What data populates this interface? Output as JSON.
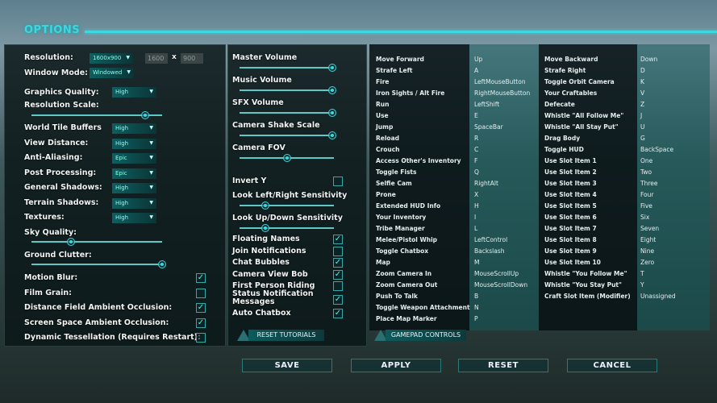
{
  "title": "OPTIONS",
  "colors": {
    "accent": "#3fd6e0",
    "panel": "#0a1618"
  },
  "graphics": {
    "resolution": {
      "label": "Resolution:",
      "value": "1600x900",
      "width": "1600",
      "x": "x",
      "height": "900"
    },
    "window_mode": {
      "label": "Window Mode:",
      "value": "Windowed"
    },
    "graphics_quality": {
      "label": "Graphics Quality:",
      "value": "High"
    },
    "resolution_scale": {
      "label": "Resolution Scale:",
      "value": 0.87
    },
    "dropdowns": [
      {
        "label": "World Tile Buffers",
        "value": "High"
      },
      {
        "label": "View Distance:",
        "value": "High"
      },
      {
        "label": "Anti-Aliasing:",
        "value": "Epic"
      },
      {
        "label": "Post Processing:",
        "value": "Epic"
      },
      {
        "label": "General Shadows:",
        "value": "High"
      },
      {
        "label": "Terrain Shadows:",
        "value": "High"
      },
      {
        "label": "Textures:",
        "value": "High"
      }
    ],
    "sky_quality": {
      "label": "Sky Quality:",
      "value": 0.3
    },
    "ground_clutter": {
      "label": "Ground Clutter:",
      "value": 1.0
    },
    "checkboxes": [
      {
        "label": "Motion Blur:",
        "checked": true
      },
      {
        "label": "Film Grain:",
        "checked": false
      },
      {
        "label": "Distance Field Ambient Occlusion:",
        "checked": true
      },
      {
        "label": "Screen Space Ambient Occlusion:",
        "checked": true
      },
      {
        "label": "Dynamic Tessellation (Requires Restart):",
        "checked": false
      }
    ]
  },
  "audio": {
    "sliders": [
      {
        "label": "Master Volume",
        "value": 0.98
      },
      {
        "label": "Music Volume",
        "value": 0.98
      },
      {
        "label": "SFX Volume",
        "value": 0.98
      },
      {
        "label": "Camera Shake Scale",
        "value": 0.98
      },
      {
        "label": "Camera FOV",
        "value": 0.5
      }
    ],
    "invert_y": {
      "label": "Invert Y",
      "checked": false
    },
    "sens": [
      {
        "label": "Look Left/Right Sensitivity",
        "value": 0.27
      },
      {
        "label": "Look Up/Down Sensitivity",
        "value": 0.27
      }
    ],
    "checkboxes": [
      {
        "label": "Floating Names",
        "checked": true
      },
      {
        "label": "Join Notifications",
        "checked": false
      },
      {
        "label": "Chat Bubbles",
        "checked": true
      },
      {
        "label": "Camera View Bob",
        "checked": true
      },
      {
        "label": "First Person Riding",
        "checked": false
      },
      {
        "label": "Status Notification Messages",
        "checked": true
      },
      {
        "label": "Auto Chatbox",
        "checked": true
      }
    ],
    "reset_tutorials": "RESET TUTORIALS"
  },
  "keybinds": {
    "left": [
      [
        "Move Forward",
        "Up"
      ],
      [
        "Strafe Left",
        "A"
      ],
      [
        "Fire",
        "LeftMouseButton"
      ],
      [
        "Iron Sights / Alt Fire",
        "RightMouseButton"
      ],
      [
        "Run",
        "LeftShift"
      ],
      [
        "Use",
        "E"
      ],
      [
        "Jump",
        "SpaceBar"
      ],
      [
        "Reload",
        "R"
      ],
      [
        "Crouch",
        "C"
      ],
      [
        "Access Other's Inventory",
        "F"
      ],
      [
        "Toggle Fists",
        "Q"
      ],
      [
        "Selfie Cam",
        "RightAlt"
      ],
      [
        "Prone",
        "X"
      ],
      [
        "Extended HUD Info",
        "H"
      ],
      [
        "Your Inventory",
        "I"
      ],
      [
        "Tribe Manager",
        "L"
      ],
      [
        "Melee/Pistol Whip",
        "LeftControl"
      ],
      [
        "Toggle Chatbox",
        "Backslash"
      ],
      [
        "Map",
        "M"
      ],
      [
        "Zoom Camera In",
        "MouseScrollUp"
      ],
      [
        "Zoom Camera Out",
        "MouseScrollDown"
      ],
      [
        "Push To Talk",
        "B"
      ],
      [
        "Toggle Weapon Attachment",
        "N"
      ],
      [
        "Place Map Marker",
        "P"
      ]
    ],
    "right": [
      [
        "Move Backward",
        "Down"
      ],
      [
        "Strafe Right",
        "D"
      ],
      [
        "Toggle Orbit Camera",
        "K"
      ],
      [
        "Your Craftables",
        "V"
      ],
      [
        "Defecate",
        "Z"
      ],
      [
        "Whistle \"All Follow Me\"",
        "J"
      ],
      [
        "Whistle \"All Stay Put\"",
        "U"
      ],
      [
        "Drag Body",
        "G"
      ],
      [
        "Toggle HUD",
        "BackSpace"
      ],
      [
        "Use Slot Item 1",
        "One"
      ],
      [
        "Use Slot Item 2",
        "Two"
      ],
      [
        "Use Slot Item 3",
        "Three"
      ],
      [
        "Use Slot Item 4",
        "Four"
      ],
      [
        "Use Slot Item 5",
        "Five"
      ],
      [
        "Use Slot Item 6",
        "Six"
      ],
      [
        "Use Slot Item 7",
        "Seven"
      ],
      [
        "Use Slot Item 8",
        "Eight"
      ],
      [
        "Use Slot Item 9",
        "Nine"
      ],
      [
        "Use Slot Item 10",
        "Zero"
      ],
      [
        "Whistle \"You Follow Me\"",
        "T"
      ],
      [
        "Whistle \"You Stay Put\"",
        "Y"
      ],
      [
        "Craft Slot Item (Modifier)",
        "Unassigned"
      ]
    ],
    "gamepad_controls": "GAMEPAD CONTROLS"
  },
  "buttons": {
    "save": "SAVE",
    "apply": "APPLY",
    "reset": "RESET",
    "cancel": "CANCEL"
  }
}
